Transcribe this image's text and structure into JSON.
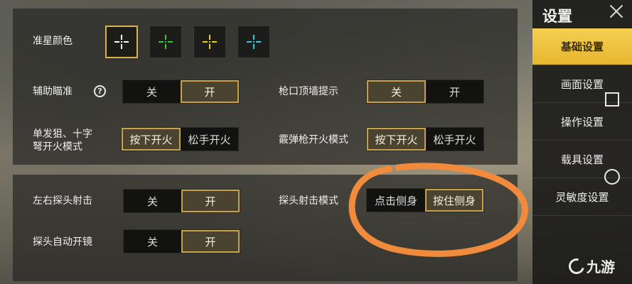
{
  "sidebar": {
    "title": "设置",
    "items": [
      {
        "label": "基础设置",
        "active": true
      },
      {
        "label": "画面设置",
        "active": false
      },
      {
        "label": "操作设置",
        "active": false
      },
      {
        "label": "载具设置",
        "active": false
      },
      {
        "label": "灵敏度设置",
        "active": false
      }
    ]
  },
  "crosshair": {
    "label": "准星颜色",
    "colors": [
      "#ffffff",
      "#2ecc40",
      "#f1d400",
      "#30d0e8"
    ],
    "selected_index": 0
  },
  "aim_assist": {
    "label": "辅助瞄准",
    "help_icon": "?",
    "options": [
      "关",
      "开"
    ],
    "selected": "开"
  },
  "muzzle_wall_hint": {
    "label": "枪口顶墙提示",
    "options": [
      "关",
      "开"
    ],
    "selected": "关"
  },
  "single_fire": {
    "label_line1": "单发狙、十字",
    "label_line2": "弩开火模式",
    "options": [
      "按下开火",
      "松手开火"
    ],
    "selected": "按下开火"
  },
  "shotgun_fire": {
    "label": "霰弹枪开火模式",
    "options": [
      "按下开火",
      "松手开火"
    ],
    "selected": "按下开火"
  },
  "peek_fire": {
    "label": "左右探头射击",
    "options": [
      "关",
      "开"
    ],
    "selected": "开"
  },
  "peek_fire_mode": {
    "label": "探头射击模式",
    "options": [
      "点击侧身",
      "按住侧身"
    ],
    "selected": "按住侧身"
  },
  "peek_auto_scope": {
    "label": "探头自动开镜",
    "options": [
      "关",
      "开"
    ],
    "selected": "开"
  },
  "watermark": {
    "text": "九游"
  },
  "colors": {
    "accent": "#c9a247",
    "sidebar_active": "#f0c43c",
    "annotation": "#f08a3c"
  }
}
